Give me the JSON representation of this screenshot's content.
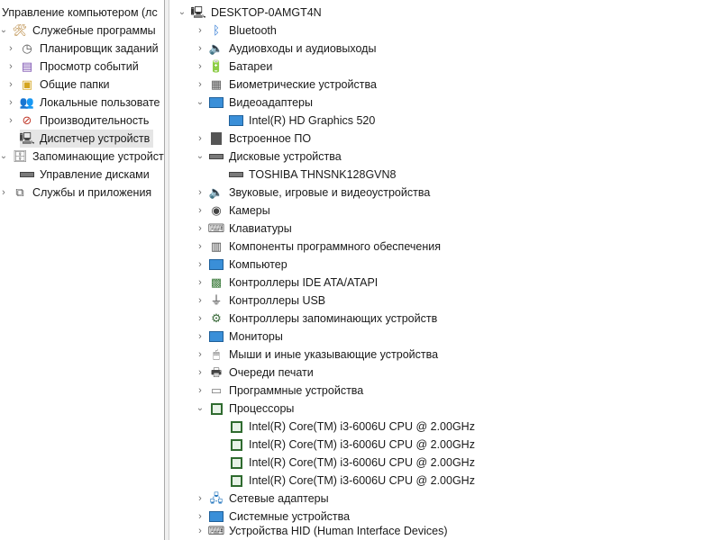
{
  "left_tree": {
    "root": "Управление компьютером (лс",
    "items": [
      {
        "label": "Служебные программы"
      },
      {
        "label": "Планировщик заданий"
      },
      {
        "label": "Просмотр событий"
      },
      {
        "label": "Общие папки"
      },
      {
        "label": "Локальные пользовате"
      },
      {
        "label": "Производительность"
      },
      {
        "label": "Диспетчер устройств"
      },
      {
        "label": "Запоминающие устройств"
      },
      {
        "label": "Управление дисками"
      },
      {
        "label": "Службы и приложения"
      }
    ]
  },
  "device_tree": {
    "root": "DESKTOP-0AMGT4N",
    "items": [
      {
        "label": "Bluetooth"
      },
      {
        "label": "Аудиовходы и аудиовыходы"
      },
      {
        "label": "Батареи"
      },
      {
        "label": "Биометрические устройства"
      },
      {
        "label": "Видеоадаптеры"
      },
      {
        "label": "Intel(R) HD Graphics 520"
      },
      {
        "label": "Встроенное ПО"
      },
      {
        "label": "Дисковые устройства"
      },
      {
        "label": "TOSHIBA THNSNK128GVN8"
      },
      {
        "label": "Звуковые, игровые и видеоустройства"
      },
      {
        "label": "Камеры"
      },
      {
        "label": "Клавиатуры"
      },
      {
        "label": "Компоненты программного обеспечения"
      },
      {
        "label": "Компьютер"
      },
      {
        "label": "Контроллеры IDE ATA/ATAPI"
      },
      {
        "label": "Контроллеры USB"
      },
      {
        "label": "Контроллеры запоминающих устройств"
      },
      {
        "label": "Мониторы"
      },
      {
        "label": "Мыши и иные указывающие устройства"
      },
      {
        "label": "Очереди печати"
      },
      {
        "label": "Программные устройства"
      },
      {
        "label": "Процессоры"
      },
      {
        "label": "Intel(R) Core(TM) i3-6006U CPU @ 2.00GHz"
      },
      {
        "label": "Intel(R) Core(TM) i3-6006U CPU @ 2.00GHz"
      },
      {
        "label": "Intel(R) Core(TM) i3-6006U CPU @ 2.00GHz"
      },
      {
        "label": "Intel(R) Core(TM) i3-6006U CPU @ 2.00GHz"
      },
      {
        "label": "Сетевые адаптеры"
      },
      {
        "label": "Системные устройства"
      },
      {
        "label": "Устройства HID (Human Interface Devices)"
      }
    ]
  },
  "colors": {
    "selection": "#e5e5e5",
    "divider": "#f0f0f0",
    "chevron": "#6b6b6b"
  }
}
